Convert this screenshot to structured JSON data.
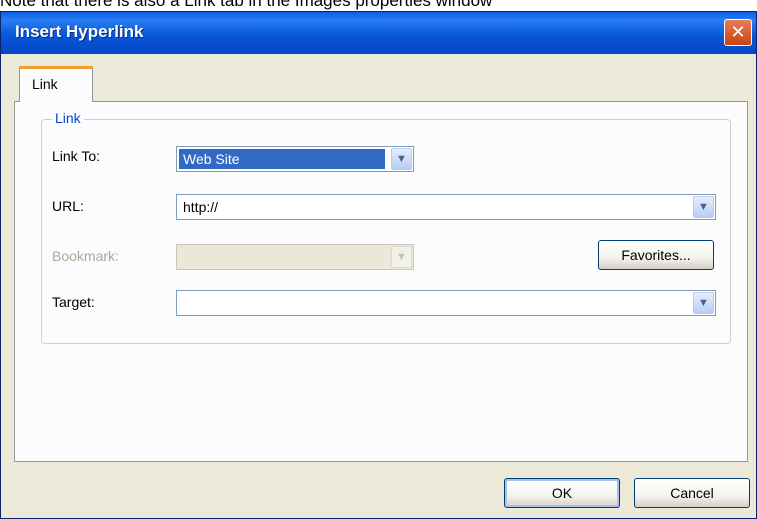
{
  "caption": "Note that there is also a Link tab in the Images properties window",
  "dialog": {
    "title": "Insert Hyperlink",
    "close_symbol": "✕"
  },
  "tabs": [
    "Link"
  ],
  "group": {
    "title": "Link",
    "link_to": {
      "label": "Link To:",
      "value": "Web Site"
    },
    "url": {
      "label": "URL:",
      "value": "http://"
    },
    "bookmark": {
      "label": "Bookmark:",
      "value": ""
    },
    "target": {
      "label": "Target:",
      "value": ""
    },
    "favorites_label": "Favorites..."
  },
  "footer": {
    "ok_label": "OK",
    "cancel_label": "Cancel"
  },
  "icons": {
    "dropdown": "chevron-down-icon",
    "close": "close-icon"
  },
  "colors": {
    "title_bar": "#0757d9",
    "close_button": "#c8410f",
    "selection": "#316ac5",
    "group_legend": "#0046d5",
    "tab_highlight": "#f0a030"
  }
}
